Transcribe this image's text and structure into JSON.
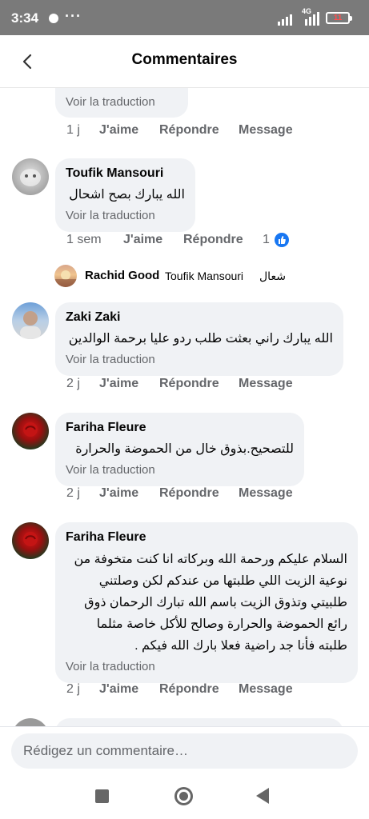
{
  "status_bar": {
    "time": "3:34",
    "more": "···",
    "network": "4G",
    "battery": "11",
    "icons": [
      "notification-dot-icon",
      "signal-icon",
      "battery-icon"
    ]
  },
  "header": {
    "title": "Commentaires",
    "back_icon": "chevron-left-icon"
  },
  "comments": [
    {
      "author": "",
      "text": "",
      "translate": "Voir la traduction",
      "time": "1 j",
      "like": "J'aime",
      "reply": "Répondre",
      "message": "Message"
    },
    {
      "author": "Toufik Mansouri",
      "text": "الله يبارك بصح اشحال",
      "translate": "Voir la traduction",
      "time": "1 sem",
      "like": "J'aime",
      "reply": "Répondre",
      "message": "",
      "like_count": "1"
    },
    {
      "author": "Zaki Zaki",
      "text": "الله يبارك راني بعثت طلب ردو عليا برحمة الوالدين",
      "translate": "Voir la traduction",
      "time": "2 j",
      "like": "J'aime",
      "reply": "Répondre",
      "message": "Message"
    },
    {
      "author": "Fariha Fleure",
      "text": "للتصحيح.بذوق خال من الحموضة والحرارة",
      "translate": "Voir la traduction",
      "time": "2 j",
      "like": "J'aime",
      "reply": "Répondre",
      "message": "Message"
    },
    {
      "author": "Fariha Fleure",
      "text_lines": [
        "السلام عليكم ورحمة الله وبركاته انا كنت متخوفة من",
        "نوعية الزيت اللي طلبتها من عندكم لكن وصلتني",
        "طلبيتي وتذوق الزيت باسم الله تبارك الرحمان ذوق",
        "رائع  الحموضة والحرارة وصالح للأكل خاصة مثلما",
        "طلبته فأنا جد راضية فعلا بارك الله فيكم ."
      ],
      "translate": "Voir la traduction",
      "time": "2 j",
      "like": "J'aime",
      "reply": "Répondre",
      "message": "Message"
    }
  ],
  "reply_preview": {
    "author": "Rachid Good",
    "tag": "Toufik Mansouri",
    "text": "شعال"
  },
  "composer": {
    "placeholder": "Rédigez un commentaire…"
  },
  "nav": {
    "icons": [
      "recent-apps-icon",
      "home-icon",
      "back-icon"
    ]
  }
}
